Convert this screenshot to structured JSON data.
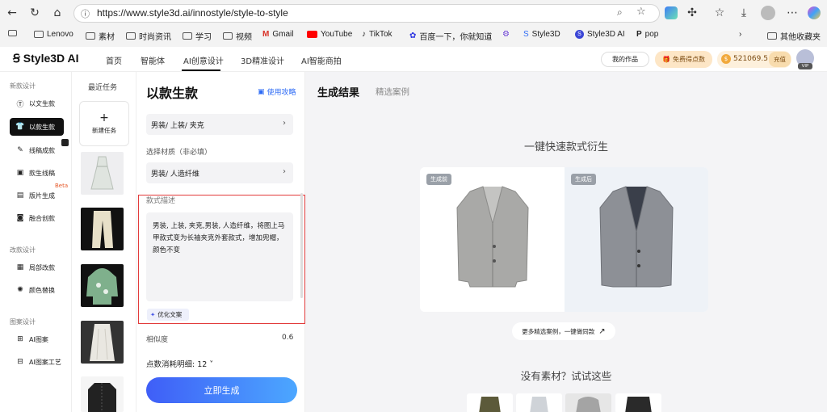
{
  "browser": {
    "url": "https://www.style3d.ai/innostyle/style-to-style",
    "bookmarks": [
      "Lenovo",
      "素材",
      "时尚资讯",
      "学习",
      "视频",
      "Gmail",
      "YouTube",
      "TikTok",
      "百度一下，你就知道",
      "Style3D",
      "Style3D AI",
      "pop"
    ],
    "other_bookmarks": "其他收藏夹"
  },
  "header": {
    "logo": "Style3D AI",
    "nav": [
      "首页",
      "智能体",
      "AI创意设计",
      "3D精准设计",
      "AI智能商拍"
    ],
    "my_works": "我的作品",
    "free_points": "免费得点数",
    "coins": "521069.5",
    "tier": "充值",
    "vip": "VIP"
  },
  "sidebar": {
    "section1": "新款设计",
    "items1": [
      "以文生款",
      "以款生款",
      "线稿成款",
      "款生线稿",
      "版片生成",
      "融合创款"
    ],
    "beta": "Beta",
    "section2": "改款设计",
    "items2": [
      "局部改款",
      "颜色替换"
    ],
    "section3": "图案设计",
    "items3": [
      "AI图案",
      "AI图案工艺"
    ]
  },
  "recent": {
    "title": "最近任务",
    "new_task": "新建任务",
    "plus": "+"
  },
  "form": {
    "title": "以款生款",
    "guide": "使用攻略",
    "category": "男装/ 上装/ 夹克",
    "material_label": "选择材质（非必填）",
    "material": "男装/ 人造纤维",
    "desc_label": "款式描述",
    "desc": "男装, 上装, 夹克,男装, 人造纤维，将图上马甲款式变为长袖夹克外套款式，增加兜帽，颜色不变",
    "optimize": "优化文案",
    "similarity_label": "相似度",
    "similarity_value": "0.6",
    "cost": "点数消耗明细: 12 ˅",
    "generate": "立即生成"
  },
  "result": {
    "tab_result": "生成结果",
    "tab_cases": "精选案例",
    "headline": "一键快速款式衍生",
    "before_tag": "生成前",
    "after_tag": "生成后",
    "more": "更多精选案例，一键做同款",
    "no_material": "没有素材？试试这些"
  },
  "colors": {
    "accent_blue": "#2f6cf5",
    "highlight_red": "#e23b3b",
    "btn_gradient_start": "#3f5ef7",
    "btn_gradient_end": "#4ca7ff"
  }
}
